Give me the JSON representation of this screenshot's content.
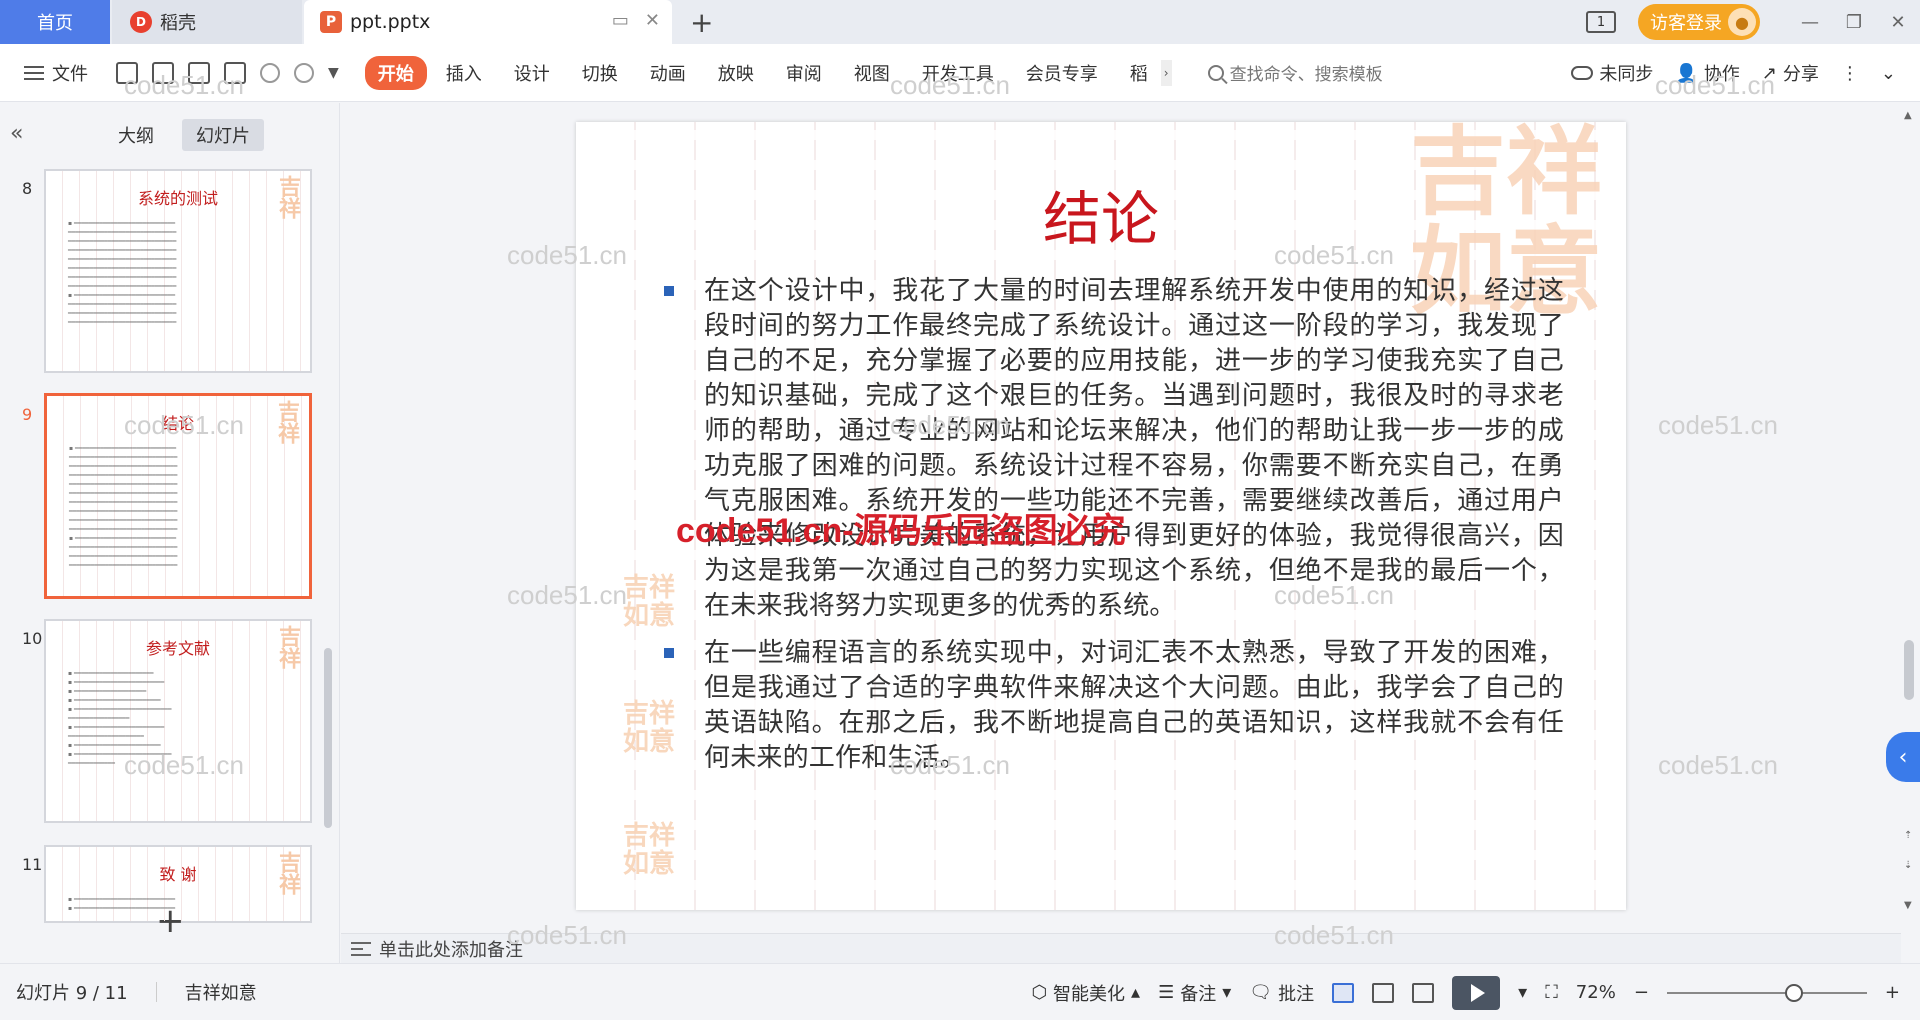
{
  "tabbar": {
    "home_label": "首页",
    "daoke_label": "稻壳",
    "doc_label": "ppt.pptx",
    "visitor_label": "访客登录",
    "page_badge": "1"
  },
  "toolbar": {
    "file_label": "文件",
    "ribbon_tabs": [
      "开始",
      "插入",
      "设计",
      "切换",
      "动画",
      "放映",
      "审阅",
      "视图",
      "开发工具",
      "会员专享",
      "稻"
    ],
    "search_placeholder": "查找命令、搜索模板",
    "sync_label": "未同步",
    "collab_label": "协作",
    "share_label": "分享"
  },
  "leftpanel": {
    "tab_outline": "大纲",
    "tab_slides": "幻灯片",
    "thumbs": [
      {
        "num": "8",
        "title": "系统的测试"
      },
      {
        "num": "9",
        "title": "结论"
      },
      {
        "num": "10",
        "title": "参考文献"
      },
      {
        "num": "11",
        "title": "致  谢"
      }
    ]
  },
  "slide": {
    "title": "结论",
    "paragraphs": [
      "在这个设计中，我花了大量的时间去理解系统开发中使用的知识，经过这段时间的努力工作最终完成了系统设计。通过这一阶段的学习，我发现了自己的不足，充分掌握了必要的应用技能，进一步的学习使我充实了自己的知识基础，完成了这个艰巨的任务。当遇到问题时，我很及时的寻求老师的帮助，通过专业的网站和论坛来解决，他们的帮助让我一步一步的成功克服了困难的问题。系统设计过程不容易，你需要不断充实自己，在勇气克服困难。系统开发的一些功能还不完善，需要继续改善后，通过用户体验来修改设计完美的系统，让用户得到更好的体验，我觉得很高兴，因为这是我第一次通过自己的努力实现这个系统，但绝不是我的最后一个，在未来我将努力实现更多的优秀的系统。",
      "在一些编程语言的系统实现中，对词汇表不太熟悉，导致了开发的困难，但是我通过了合适的字典软件来解决这个大问题。由此，我学会了自己的英语缺陷。在那之后，我不断地提高自己的英语知识，这样我就不会有任何未来的工作和生活。"
    ]
  },
  "notes": {
    "placeholder": "单击此处添加备注"
  },
  "watermarks": {
    "gray": "code51.cn",
    "red": "code51.cn-源码乐园盗图必究"
  },
  "statusbar": {
    "slide_count": "幻灯片 9 / 11",
    "theme": "吉祥如意",
    "beautify": "智能美化",
    "notes_label": "备注",
    "comment_label": "批注",
    "zoom": "72%"
  }
}
